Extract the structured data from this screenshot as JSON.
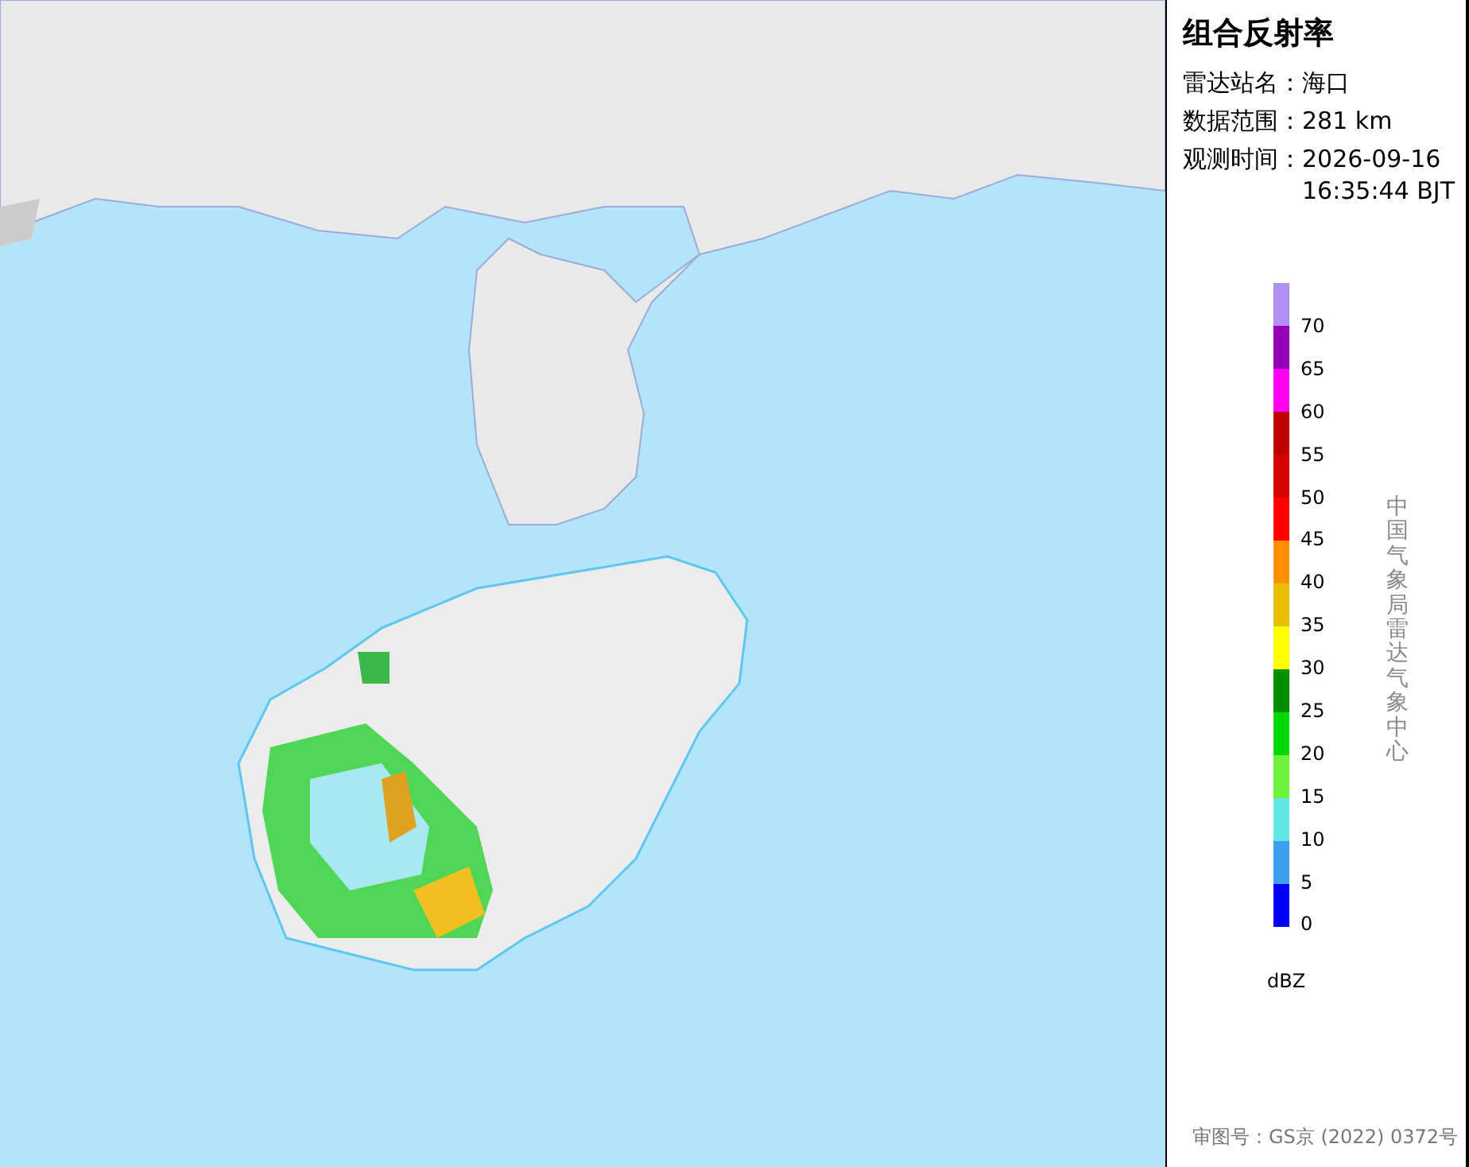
{
  "panel": {
    "title": "组合反射率",
    "info": [
      {
        "label": "雷达站名：",
        "value": "海口"
      },
      {
        "label": "数据范围：",
        "value": "281 km"
      },
      {
        "label": "观测时间：",
        "value": "2026-09-16 16:35:44 BJT"
      }
    ],
    "legend": {
      "unit": "dBZ",
      "segments": [
        {
          "color": "#ad90f0"
        },
        {
          "color": "#9600b4"
        },
        {
          "color": "#ff00f0"
        },
        {
          "color": "#c00000"
        },
        {
          "color": "#d60000"
        },
        {
          "color": "#ff0000"
        },
        {
          "color": "#ff9000"
        },
        {
          "color": "#e7c000"
        },
        {
          "color": "#ffff00"
        },
        {
          "color": "#008f00"
        },
        {
          "color": "#00d800"
        },
        {
          "color": "#6ff43c"
        },
        {
          "color": "#62e5e5"
        },
        {
          "color": "#3c9ff0"
        },
        {
          "color": "#0000f6"
        }
      ],
      "ticks": [
        "70",
        "65",
        "60",
        "55",
        "50",
        "45",
        "40",
        "35",
        "30",
        "25",
        "20",
        "15",
        "10",
        "5",
        "0"
      ]
    },
    "vertical_caption": "中国气象局雷达气象中心",
    "approval": "审图号：GS京 (2022) 0372号"
  }
}
